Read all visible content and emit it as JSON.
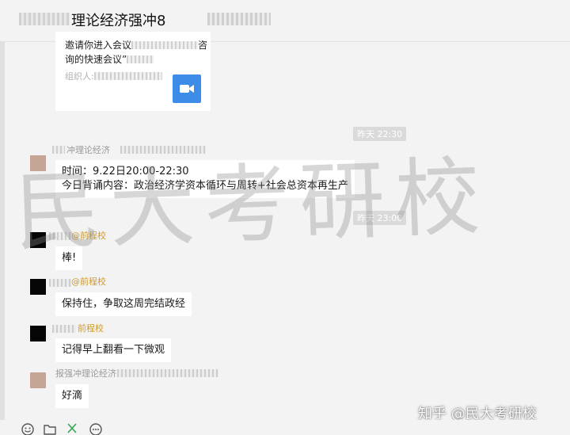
{
  "header": {
    "title": "理论经济强冲8"
  },
  "meeting_card": {
    "line1": "邀请你进入会议",
    "line1_tail": "咨",
    "line2": "询的快速会议”",
    "organizer_label": "组织人:"
  },
  "timestamps": {
    "t1": "昨天 22:30",
    "t2": "昨天 23:00"
  },
  "messages": [
    {
      "sender": "冲理论经济",
      "text_line1": "时间：9.22日20:00-22:30",
      "text_line2": "今日背诵内容：政治经济学资本循环与周转+社会总资本再生产"
    },
    {
      "tag": "@前程校",
      "text": "棒!"
    },
    {
      "tag": "@前程校",
      "text": "保持住，争取这周完结政经"
    },
    {
      "tag": "前程校",
      "text": "记得早上翻看一下微观"
    },
    {
      "sender": "报强冲理论经济",
      "text": "好滴"
    }
  ],
  "watermark": "民大考研校",
  "source_mark": "知乎 @民大考研校",
  "colors": {
    "accent": "#3d8de8",
    "tag": "#d19a2a",
    "background": "#f3f3f3"
  },
  "toolbar_icons": [
    "smiley-icon",
    "folder-icon",
    "scissors-icon",
    "more-icon"
  ]
}
